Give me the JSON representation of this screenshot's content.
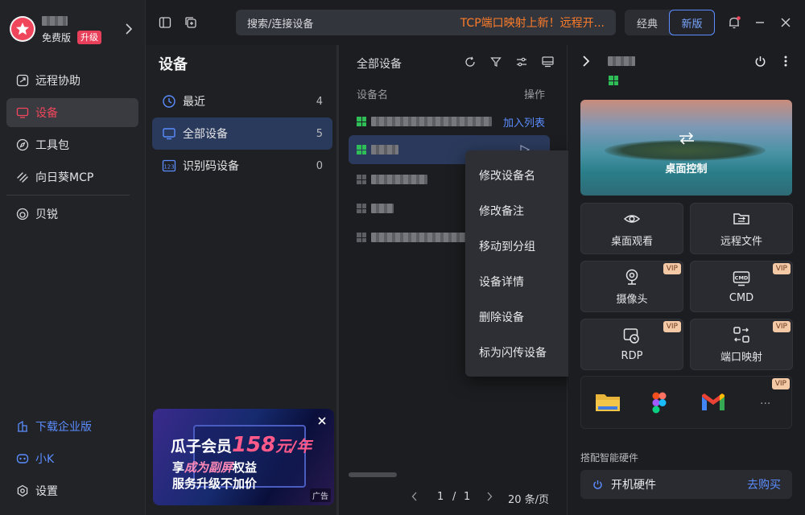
{
  "user": {
    "tier": "免费版",
    "upgrade": "升级"
  },
  "nav": {
    "items": [
      {
        "label": "远程协助",
        "icon": "remote-assist-icon",
        "active": false
      },
      {
        "label": "设备",
        "icon": "monitor-icon",
        "active": true
      },
      {
        "label": "工具包",
        "icon": "compass-icon",
        "active": false
      },
      {
        "label": "向日葵MCP",
        "icon": "mcp-icon",
        "active": false
      },
      {
        "label": "贝锐",
        "icon": "oray-icon",
        "active": false
      }
    ],
    "bottom": [
      {
        "label": "下载企业版",
        "icon": "enterprise-icon",
        "color": "#5b8dff"
      },
      {
        "label": "小K",
        "icon": "assistant-icon",
        "color": "#5b8dff"
      },
      {
        "label": "设置",
        "icon": "gear-icon",
        "color": "#e2e2e4"
      }
    ]
  },
  "topbar": {
    "search_placeholder": "搜索/连接设备",
    "promo": "TCP端口映射上新！远程开...",
    "mode_classic": "经典",
    "mode_new": "新版"
  },
  "groups": {
    "title": "设备",
    "items": [
      {
        "label": "最近",
        "count": "4",
        "icon": "clock-icon"
      },
      {
        "label": "全部设备",
        "count": "5",
        "icon": "monitor-icon"
      },
      {
        "label": "识别码设备",
        "count": "0",
        "icon": "code-123-icon"
      }
    ]
  },
  "ad": {
    "line1a": "瓜子会员",
    "line1b": "158",
    "line1c": "元/年",
    "line2a": "享",
    "line2b": "成为副屏",
    "line2c": "权益",
    "line3": "服务升级不加价",
    "badge": "广告"
  },
  "list": {
    "title": "全部设备",
    "col_name": "设备名",
    "col_action": "操作",
    "add_to_list": "加入列表",
    "pagination": {
      "page": "1",
      "sep": "/",
      "total": "1",
      "per_page": "20 条/页"
    }
  },
  "context_menu": [
    "修改设备名",
    "修改备注",
    "移动到分组",
    "设备详情",
    "删除设备",
    "标为闪传设备"
  ],
  "detail": {
    "desktop_control": "桌面控制",
    "features": [
      {
        "label": "桌面观看",
        "icon": "eye-icon",
        "vip": false
      },
      {
        "label": "远程文件",
        "icon": "folder-transfer-icon",
        "vip": false
      },
      {
        "label": "摄像头",
        "icon": "camera-icon",
        "vip": true
      },
      {
        "label": "CMD",
        "icon": "cmd-icon",
        "vip": true
      },
      {
        "label": "RDP",
        "icon": "rdp-icon",
        "vip": true
      },
      {
        "label": "端口映射",
        "icon": "port-map-icon",
        "vip": true
      }
    ],
    "vip": "VIP",
    "more": "...",
    "hardware_title": "搭配智能硬件",
    "hardware_item": "开机硬件",
    "buy": "去购买"
  }
}
